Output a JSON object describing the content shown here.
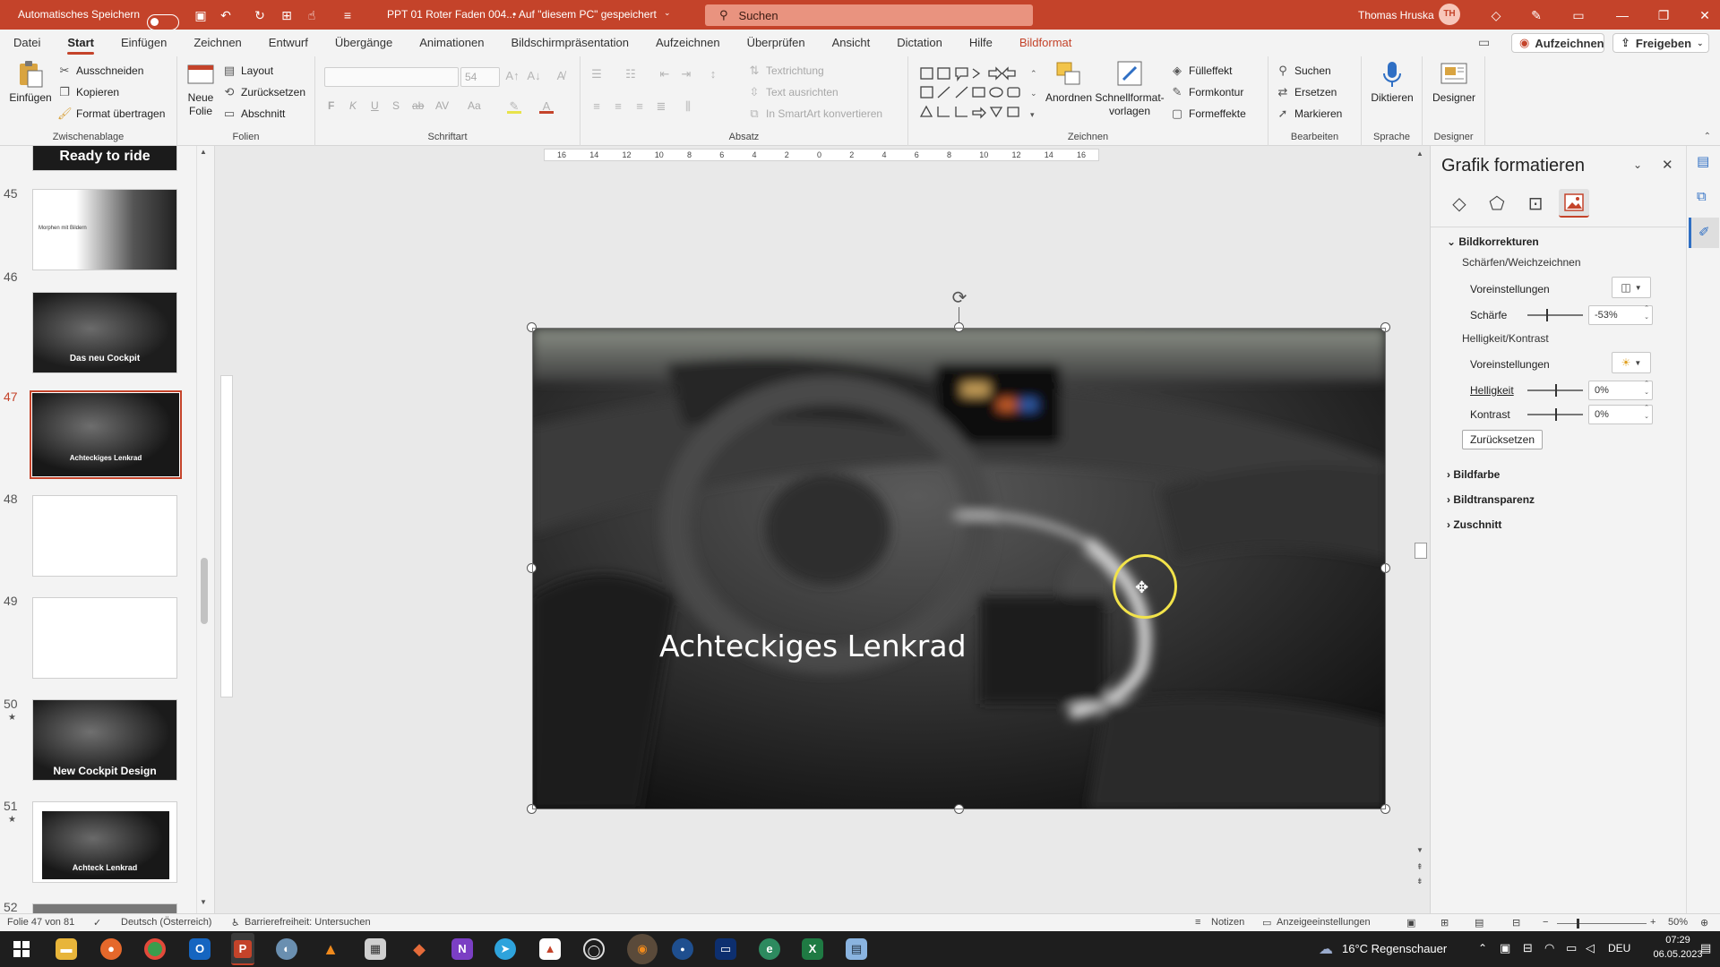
{
  "titlebar": {
    "autosave_label": "Automatisches Speichern",
    "doc_title": "PPT 01 Roter Faden 004...",
    "saved_state": "• Auf \"diesem PC\" gespeichert",
    "search_placeholder": "Suchen",
    "user_name": "Thomas Hruska",
    "user_initials": "TH"
  },
  "tabs": [
    "Datei",
    "Start",
    "Einfügen",
    "Zeichnen",
    "Entwurf",
    "Übergänge",
    "Animationen",
    "Bildschirmpräsentation",
    "Aufzeichnen",
    "Überprüfen",
    "Ansicht",
    "Dictation",
    "Hilfe",
    "Bildformat"
  ],
  "header_buttons": {
    "record": "Aufzeichnen",
    "share": "Freigeben"
  },
  "ribbon": {
    "clipboard": {
      "paste": "Einfügen",
      "cut": "Ausschneiden",
      "copy": "Kopieren",
      "format_painter": "Format übertragen",
      "label": "Zwischenablage"
    },
    "slides": {
      "new_slide": "Neue Folie",
      "layout": "Layout",
      "reset": "Zurücksetzen",
      "section": "Abschnitt",
      "label": "Folien"
    },
    "font": {
      "size": "54",
      "label": "Schriftart",
      "bold": "F",
      "italic": "K",
      "underline": "U",
      "shadow": "S",
      "strike": "ab",
      "spacing": "AV",
      "case": "Aa"
    },
    "paragraph": {
      "text_direction": "Textrichtung",
      "align_text": "Text ausrichten",
      "smartart": "In SmartArt konvertieren",
      "label": "Absatz"
    },
    "drawing": {
      "arrange": "Anordnen",
      "quick_styles": "Schnellformat-vorlagen",
      "fill": "Fülleffekt",
      "outline": "Formkontur",
      "effects": "Formeffekte",
      "label": "Zeichnen"
    },
    "editing": {
      "find": "Suchen",
      "replace": "Ersetzen",
      "select": "Markieren",
      "label": "Bearbeiten"
    },
    "voice": {
      "dictate": "Diktieren",
      "label": "Sprache"
    },
    "designer": {
      "designer": "Designer",
      "label": "Designer"
    }
  },
  "slides": [
    {
      "num": "",
      "caption": "Ready to ride",
      "starred": false
    },
    {
      "num": "45",
      "caption": "Morphen mit Bildern",
      "starred": false
    },
    {
      "num": "46",
      "caption": "Das neu Cockpit",
      "starred": false
    },
    {
      "num": "47",
      "caption": "Achteckiges Lenkrad",
      "starred": false
    },
    {
      "num": "48",
      "caption": "",
      "starred": false
    },
    {
      "num": "49",
      "caption": "",
      "starred": false
    },
    {
      "num": "50",
      "caption": "New Cockpit Design",
      "starred": true
    },
    {
      "num": "51",
      "caption": "Achteck Lenkrad",
      "starred": true
    },
    {
      "num": "52",
      "caption": "",
      "starred": false
    }
  ],
  "slide_main": {
    "caption": "Achteckiges Lenkrad"
  },
  "ruler": {
    "labels": [
      "16",
      "14",
      "12",
      "10",
      "8",
      "6",
      "4",
      "2",
      "0",
      "2",
      "4",
      "6",
      "8",
      "10",
      "12",
      "14",
      "16"
    ]
  },
  "pane": {
    "title": "Grafik formatieren",
    "sections": {
      "corrections": "Bildkorrekturen",
      "sharpen": "Schärfen/Weichzeichnen",
      "presets1": "Voreinstellungen",
      "sharpness": "Schärfe",
      "sharpness_value": "-53%",
      "brightness_contrast": "Helligkeit/Kontrast",
      "presets2": "Voreinstellungen",
      "brightness": "Helligkeit",
      "brightness_value": "0%",
      "contrast": "Kontrast",
      "contrast_value": "0%",
      "reset": "Zurücksetzen",
      "color": "Bildfarbe",
      "transparency": "Bildtransparenz",
      "crop": "Zuschnitt"
    }
  },
  "status": {
    "slide_info": "Folie 47 von 81",
    "language": "Deutsch (Österreich)",
    "accessibility": "Barrierefreiheit: Untersuchen",
    "notes": "Notizen",
    "display": "Anzeigeeinstellungen",
    "zoom": "50%"
  },
  "taskbar": {
    "weather": "16°C  Regenschauer",
    "lang": "DEU",
    "time": "07:29",
    "date": "06.05.2023"
  },
  "colors": {
    "accent": "#c4432a",
    "cursor_ring": "#f2e34a"
  }
}
